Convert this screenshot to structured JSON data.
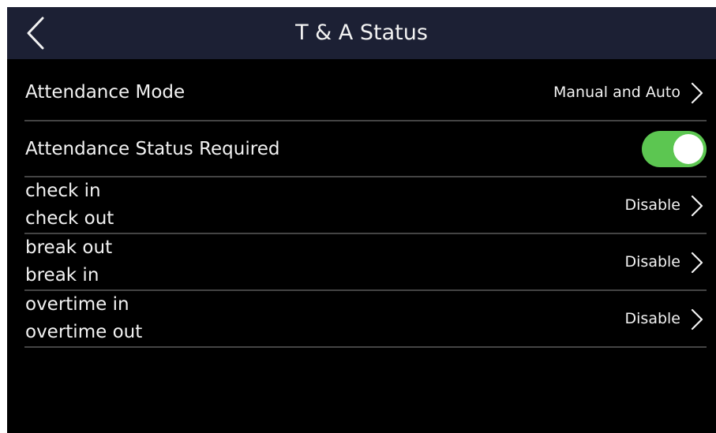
{
  "header": {
    "title": "T & A Status",
    "back_icon": "chevron-left-icon"
  },
  "settings": {
    "attendance_mode": {
      "label": "Attendance Mode",
      "value": "Manual and Auto"
    },
    "status_required": {
      "label": "Attendance Status Required",
      "enabled": true
    },
    "rows": [
      {
        "line1": "check in",
        "line2": "check out",
        "value": "Disable"
      },
      {
        "line1": "break out",
        "line2": "break in",
        "value": "Disable"
      },
      {
        "line1": "overtime in",
        "line2": "overtime out",
        "value": "Disable"
      }
    ]
  },
  "colors": {
    "header_bg": "#1c2034",
    "screen_bg": "#000000",
    "toggle_on": "#5cc651",
    "divider": "#444444",
    "text": "#f2f2f2"
  }
}
